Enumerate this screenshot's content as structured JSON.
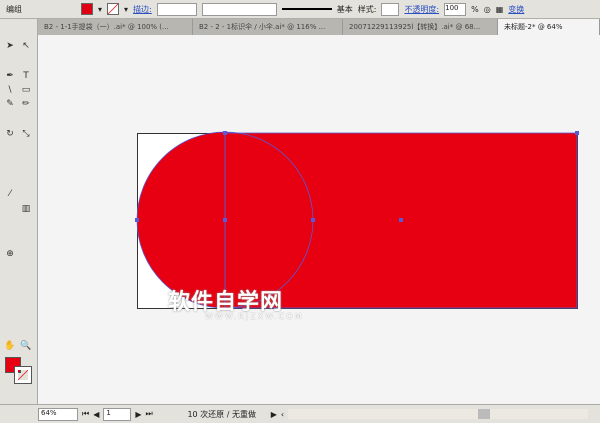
{
  "control_bar": {
    "label": "编组",
    "fill_color": "#e00014",
    "stroke_label": "描边:",
    "stroke_style": "基本",
    "style_label": "样式:",
    "opacity_label": "不透明度:",
    "opacity_value": "100",
    "opacity_unit": "%",
    "transform_label": "变换"
  },
  "tabs": [
    {
      "label": "B2 - 1-1手提袋（一）.ai* @ 100% (..."
    },
    {
      "label": "B2 - 2 - 1标识伞 / 小伞.ai* @ 116% ..."
    },
    {
      "label": "20071229113925l【转换】.ai* @ 68..."
    },
    {
      "label": "未标题-2* @ 64%",
      "active": true
    }
  ],
  "status": {
    "zoom": "64%",
    "page": "1",
    "message": "10 次还原 / 无重做"
  },
  "watermark": {
    "title": "软件自学网",
    "url": "WWW.RJZXW.COM"
  },
  "colors": {
    "red": "#e60012",
    "selection": "#5a5ad8"
  }
}
